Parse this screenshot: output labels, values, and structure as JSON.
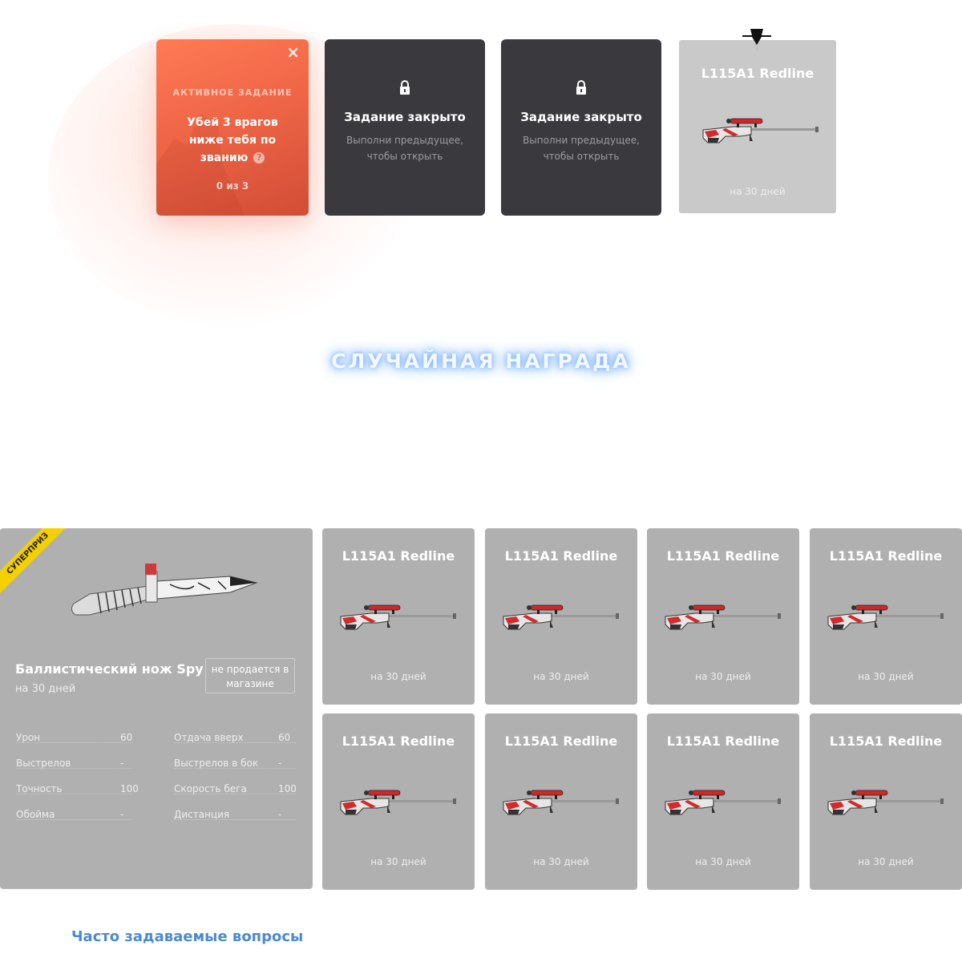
{
  "tasks": {
    "active": {
      "kicker": "АКТИВНОЕ ЗАДАНИЕ",
      "text": "Убей 3 врагов ниже тебя по званию",
      "help": "?",
      "progress": "0 из 3",
      "close": "×"
    },
    "locked": [
      {
        "title": "Задание закрыто",
        "subtitle": "Выполни предыдущее, чтобы открыть"
      },
      {
        "title": "Задание закрыто",
        "subtitle": "Выполни предыдущее, чтобы открыть"
      }
    ],
    "reward": {
      "title": "L115A1 Redline",
      "duration": "на 30 дней"
    }
  },
  "section_title": "СЛУЧАЙНАЯ НАГРАДА",
  "superprize": {
    "badge": "СУПЕРПРИЗ",
    "name": "Баллистический нож Spy",
    "duration": "на 30 дней",
    "not_sold": "не продается в магазине",
    "stats": [
      {
        "label": "Урон",
        "value": "60"
      },
      {
        "label": "Отдача вверх",
        "value": "60"
      },
      {
        "label": "Выстрелов",
        "value": "-"
      },
      {
        "label": "Выстрелов в бок",
        "value": "-"
      },
      {
        "label": "Точность",
        "value": "100"
      },
      {
        "label": "Скорость бега",
        "value": "100"
      },
      {
        "label": "Обойма",
        "value": "-"
      },
      {
        "label": "Дистанция",
        "value": "-"
      }
    ]
  },
  "rewards": [
    {
      "title": "L115A1 Redline",
      "duration": "на 30 дней"
    },
    {
      "title": "L115A1 Redline",
      "duration": "на 30 дней"
    },
    {
      "title": "L115A1 Redline",
      "duration": "на 30 дней"
    },
    {
      "title": "L115A1 Redline",
      "duration": "на 30 дней"
    },
    {
      "title": "L115A1 Redline",
      "duration": "на 30 дней"
    },
    {
      "title": "L115A1 Redline",
      "duration": "на 30 дней"
    },
    {
      "title": "L115A1 Redline",
      "duration": "на 30 дней"
    },
    {
      "title": "L115A1 Redline",
      "duration": "на 30 дней"
    }
  ],
  "faq_link": "Часто задаваемые вопросы",
  "colors": {
    "active_task": "#ef6647",
    "locked_task": "#3a3a3e",
    "card": "#b0b0b0",
    "badge": "#f5d000",
    "link": "#4a8ad0"
  }
}
